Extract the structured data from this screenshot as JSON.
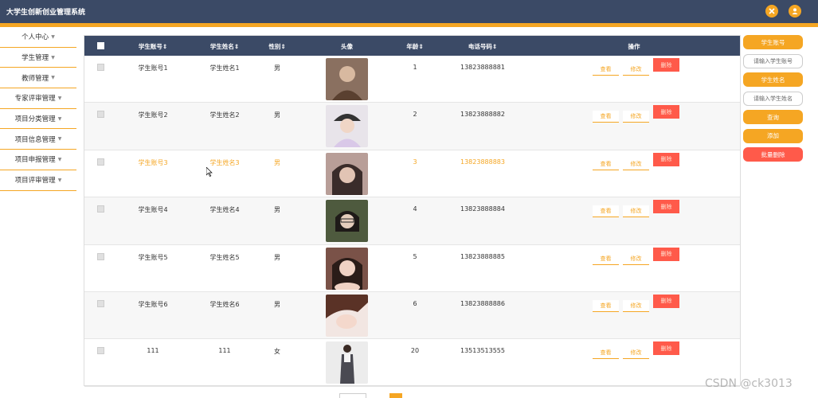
{
  "app": {
    "title": "大学生创新创业管理系统"
  },
  "sidebar": {
    "items": [
      {
        "label": "个人中心"
      },
      {
        "label": "学生管理"
      },
      {
        "label": "教师管理"
      },
      {
        "label": "专家评审管理"
      },
      {
        "label": "项目分类管理"
      },
      {
        "label": "项目信息管理"
      },
      {
        "label": "项目申报管理"
      },
      {
        "label": "项目评审管理"
      }
    ]
  },
  "table": {
    "headers": {
      "account": "学生账号",
      "name": "学生姓名",
      "gender": "性别",
      "avatar": "头像",
      "age": "年龄",
      "phone": "电话号码",
      "actions": "操作"
    },
    "sort_indicator": "⇕",
    "rows": [
      {
        "account": "学生账号1",
        "name": "学生姓名1",
        "gender": "男",
        "age": "1",
        "phone": "13823888881"
      },
      {
        "account": "学生账号2",
        "name": "学生姓名2",
        "gender": "男",
        "age": "2",
        "phone": "13823888882"
      },
      {
        "account": "学生账号3",
        "name": "学生姓名3",
        "gender": "男",
        "age": "3",
        "phone": "13823888883"
      },
      {
        "account": "学生账号4",
        "name": "学生姓名4",
        "gender": "男",
        "age": "4",
        "phone": "13823888884"
      },
      {
        "account": "学生账号5",
        "name": "学生姓名5",
        "gender": "男",
        "age": "5",
        "phone": "13823888885"
      },
      {
        "account": "学生账号6",
        "name": "学生姓名6",
        "gender": "男",
        "age": "6",
        "phone": "13823888886"
      },
      {
        "account": "111",
        "name": "111",
        "gender": "女",
        "age": "20",
        "phone": "13513513555"
      }
    ],
    "actions": {
      "view": "查看",
      "edit": "修改",
      "delete": "删除"
    }
  },
  "search_panel": {
    "account_label": "学生账号",
    "account_placeholder": "请输入学生账号",
    "name_label": "学生姓名",
    "name_placeholder": "请输入学生姓名",
    "query": "查询",
    "add": "添加",
    "batch_delete": "批量删除"
  },
  "watermark": "CSDN @ck3013",
  "colors": {
    "header_bg": "#3b4a66",
    "accent": "#f5a623",
    "danger": "#ff5a4a"
  },
  "icons": {
    "top_left_button": "close-icon",
    "top_right_button": "user-icon"
  }
}
